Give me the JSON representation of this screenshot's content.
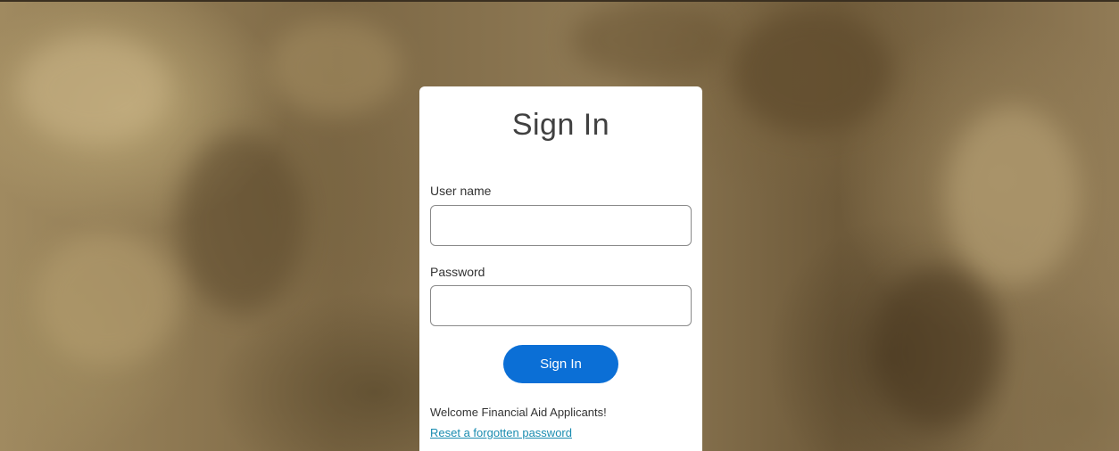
{
  "signin": {
    "title": "Sign In",
    "username_label": "User name",
    "username_value": "",
    "username_placeholder": "",
    "password_label": "Password",
    "password_value": "",
    "password_placeholder": "",
    "submit_label": "Sign In",
    "welcome_text": "Welcome Financial Aid Applicants!",
    "reset_link": "Reset a forgotten password"
  },
  "colors": {
    "primary_button": "#0b6fd6",
    "link": "#1a8cb0",
    "card_background": "#ffffff",
    "backdrop_tint": "#8a7450"
  }
}
